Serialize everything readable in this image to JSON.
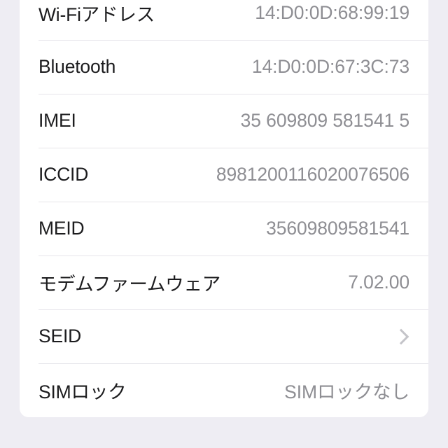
{
  "screen": {
    "name": "ios-settings-about-device-info",
    "background_color": "#eeedf3",
    "card_background_color": "#ffffff",
    "label_color": "#1c1c1e",
    "value_color": "#8e8e93",
    "separator_color": "#e6e5ea",
    "chevron_color": "#c4c4c9"
  },
  "rows": [
    {
      "label": "Wi-Fiアドレス",
      "value": "14:D0:0D:68:99:19",
      "accessory": "none"
    },
    {
      "label": "Bluetooth",
      "value": "14:D0:0D:67:3C:73",
      "accessory": "none"
    },
    {
      "label": "IMEI",
      "value": "35 609809 581541 5",
      "accessory": "none"
    },
    {
      "label": "ICCID",
      "value": "8981200116020076506",
      "accessory": "none"
    },
    {
      "label": "MEID",
      "value": "35609809581541",
      "accessory": "none"
    },
    {
      "label": "モデムファームウェア",
      "value": "7.02.00",
      "accessory": "none"
    },
    {
      "label": "SEID",
      "value": "",
      "accessory": "chevron-right-icon"
    },
    {
      "label": "SIMロック",
      "value": "SIMロックなし",
      "accessory": "none"
    }
  ]
}
